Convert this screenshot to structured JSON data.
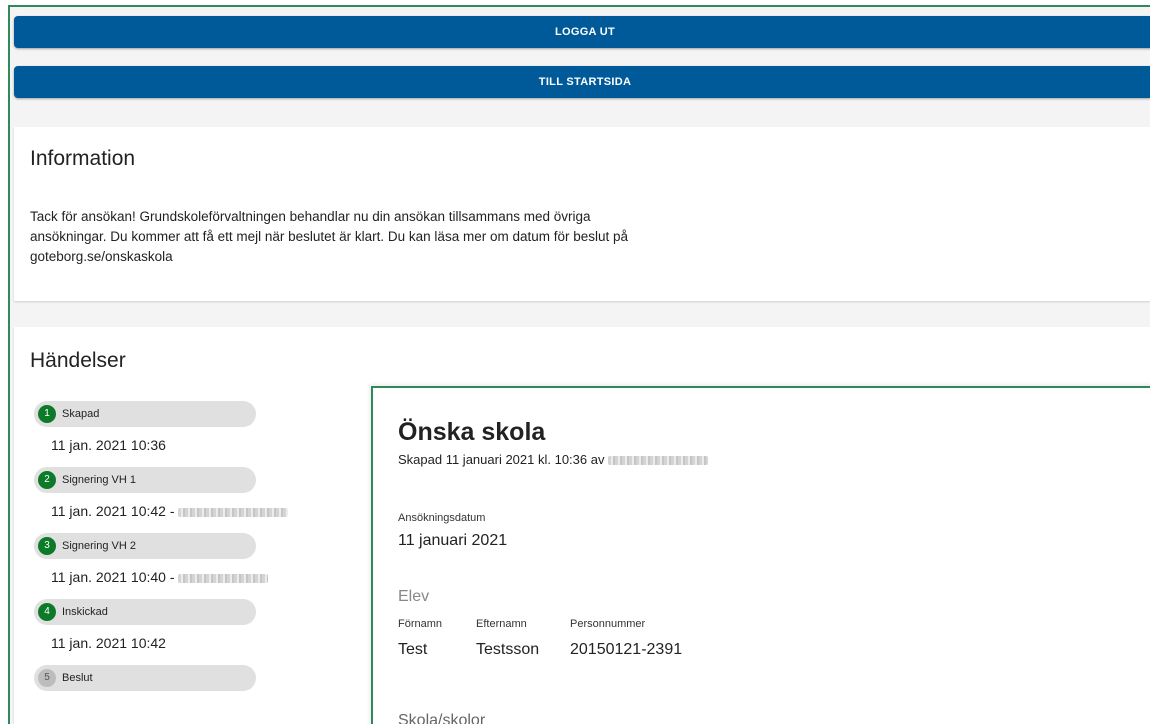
{
  "header": {
    "logout_label": "LOGGA UT",
    "home_label": "TILL STARTSIDA"
  },
  "information": {
    "title": "Information",
    "text": "Tack för ansökan! Grundskoleförvaltningen behandlar nu din ansökan tillsammans med övriga ansökningar. Du kommer att få ett mejl när beslutet är klart. Du kan läsa mer om datum för beslut på goteborg.se/onskaskola"
  },
  "events": {
    "title": "Händelser",
    "items": [
      {
        "number": "1",
        "label": "Skapad",
        "time": "11 jan. 2021 10:36",
        "done": true,
        "redacted": false
      },
      {
        "number": "2",
        "label": "Signering VH 1",
        "time": "11 jan. 2021 10:42 -",
        "done": true,
        "redacted": true
      },
      {
        "number": "3",
        "label": "Signering VH 2",
        "time": "11 jan. 2021 10:40 -",
        "done": true,
        "redacted": true
      },
      {
        "number": "4",
        "label": "Inskickad",
        "time": "11 jan. 2021 10:42",
        "done": true,
        "redacted": false
      },
      {
        "number": "5",
        "label": "Beslut",
        "time": "",
        "done": false,
        "redacted": false
      }
    ]
  },
  "application": {
    "title": "Önska skola",
    "subtitle": "Skapad 11 januari 2021 kl. 10:36 av",
    "date_label": "Ansökningsdatum",
    "date_value": "11 januari 2021",
    "student_section": "Elev",
    "firstname_label": "Förnamn",
    "firstname_value": "Test",
    "lastname_label": "Efternamn",
    "lastname_value": "Testsson",
    "ssn_label": "Personnummer",
    "ssn_value": "20150121-2391",
    "schools_section": "Skola/skolor"
  },
  "colors": {
    "primary": "#005a9a",
    "done": "#0d7a2a",
    "pending": "#bdbdbd",
    "frame_border": "#2e8a5a"
  }
}
